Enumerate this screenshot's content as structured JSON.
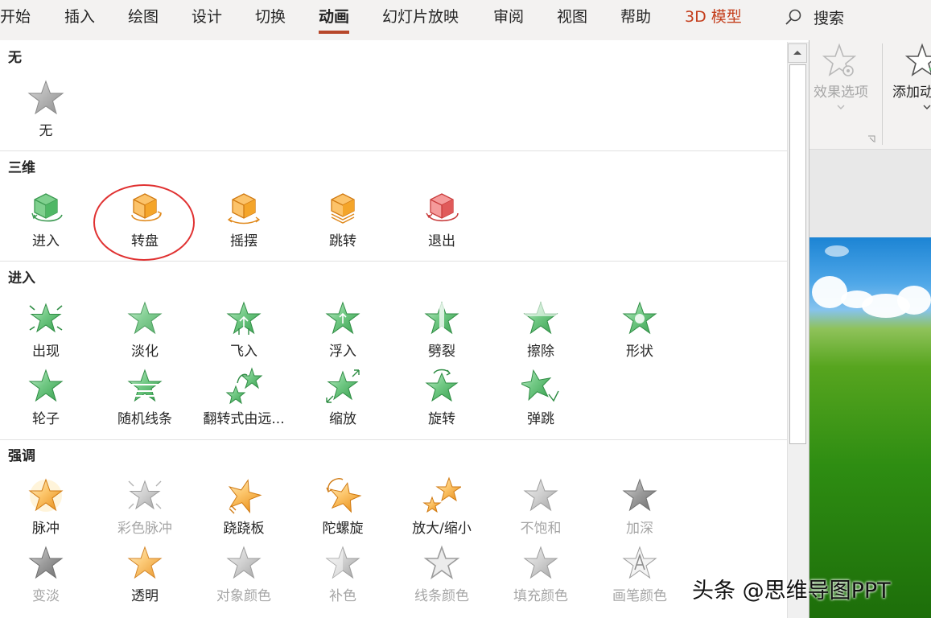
{
  "tabs": [
    {
      "label": "开始",
      "state": "normal"
    },
    {
      "label": "插入",
      "state": "normal"
    },
    {
      "label": "绘图",
      "state": "normal"
    },
    {
      "label": "设计",
      "state": "normal"
    },
    {
      "label": "切换",
      "state": "normal"
    },
    {
      "label": "动画",
      "state": "active"
    },
    {
      "label": "幻灯片放映",
      "state": "normal"
    },
    {
      "label": "审阅",
      "state": "normal"
    },
    {
      "label": "视图",
      "state": "normal"
    },
    {
      "label": "帮助",
      "state": "normal"
    },
    {
      "label": "3D 模型",
      "state": "contextual"
    }
  ],
  "search": {
    "label": "搜索",
    "icon": "search-icon"
  },
  "ribbon": {
    "effect_options": {
      "label": "效果选项",
      "icon": "star-gear-icon",
      "enabled": false
    },
    "add_animation": {
      "label": "添加动",
      "icon": "star-plus-icon"
    }
  },
  "colors": {
    "accent": "#b7472a",
    "model_tab": "#c43e1c",
    "enter_green": "#5cbf72",
    "emphasis_orange": "#f4a52a",
    "three_d_orange": "#f0a23b",
    "exit_red": "#e05a5a",
    "disabled_gray": "#a6a6a6",
    "highlight_ring": "#e03232"
  },
  "sections": {
    "none": {
      "title": "无",
      "items": [
        {
          "label": "无",
          "icon": "star-gray-icon",
          "enabled": true
        }
      ]
    },
    "three_d": {
      "title": "三维",
      "items": [
        {
          "label": "进入",
          "icon": "cube-enter-icon",
          "enabled": true
        },
        {
          "label": "转盘",
          "icon": "cube-turntable-icon",
          "enabled": true
        },
        {
          "label": "摇摆",
          "icon": "cube-swing-icon",
          "enabled": true
        },
        {
          "label": "跳转",
          "icon": "cube-jump-icon",
          "enabled": true
        },
        {
          "label": "退出",
          "icon": "cube-exit-icon",
          "enabled": true
        }
      ]
    },
    "enter": {
      "title": "进入",
      "items": [
        {
          "label": "出现",
          "icon": "star-appear-icon",
          "enabled": true
        },
        {
          "label": "淡化",
          "icon": "star-fade-icon",
          "enabled": true
        },
        {
          "label": "飞入",
          "icon": "star-fly-in-icon",
          "enabled": true
        },
        {
          "label": "浮入",
          "icon": "star-float-in-icon",
          "enabled": true
        },
        {
          "label": "劈裂",
          "icon": "star-split-icon",
          "enabled": true
        },
        {
          "label": "擦除",
          "icon": "star-wipe-icon",
          "enabled": true
        },
        {
          "label": "形状",
          "icon": "star-shape-icon",
          "enabled": true
        },
        {
          "label": "轮子",
          "icon": "star-wheel-icon",
          "enabled": true
        },
        {
          "label": "随机线条",
          "icon": "star-random-bars-icon",
          "enabled": true
        },
        {
          "label": "翻转式由远...",
          "icon": "star-grow-turn-icon",
          "enabled": true
        },
        {
          "label": "缩放",
          "icon": "star-zoom-icon",
          "enabled": true
        },
        {
          "label": "旋转",
          "icon": "star-swivel-icon",
          "enabled": true
        },
        {
          "label": "弹跳",
          "icon": "star-bounce-icon",
          "enabled": true
        }
      ]
    },
    "emphasis": {
      "title": "强调",
      "items": [
        {
          "label": "脉冲",
          "icon": "star-pulse-icon",
          "enabled": true
        },
        {
          "label": "彩色脉冲",
          "icon": "star-color-pulse-icon",
          "enabled": false
        },
        {
          "label": "跷跷板",
          "icon": "star-teeter-icon",
          "enabled": true
        },
        {
          "label": "陀螺旋",
          "icon": "star-spin-icon",
          "enabled": true
        },
        {
          "label": "放大/缩小",
          "icon": "star-grow-shrink-icon",
          "enabled": true
        },
        {
          "label": "不饱和",
          "icon": "star-desaturate-icon",
          "enabled": false
        },
        {
          "label": "加深",
          "icon": "star-darken-icon",
          "enabled": false
        },
        {
          "label": "变淡",
          "icon": "star-lighten-icon",
          "enabled": false
        },
        {
          "label": "透明",
          "icon": "star-transparency-icon",
          "enabled": true
        },
        {
          "label": "对象颜色",
          "icon": "star-object-color-icon",
          "enabled": false
        },
        {
          "label": "补色",
          "icon": "star-complementary-color-icon",
          "enabled": false
        },
        {
          "label": "线条颜色",
          "icon": "star-line-color-icon",
          "enabled": false
        },
        {
          "label": "填充颜色",
          "icon": "star-fill-color-icon",
          "enabled": false
        },
        {
          "label": "画笔颜色",
          "icon": "star-brush-color-icon",
          "enabled": false
        }
      ]
    }
  },
  "watermark": "头条 @思维导图PPT"
}
